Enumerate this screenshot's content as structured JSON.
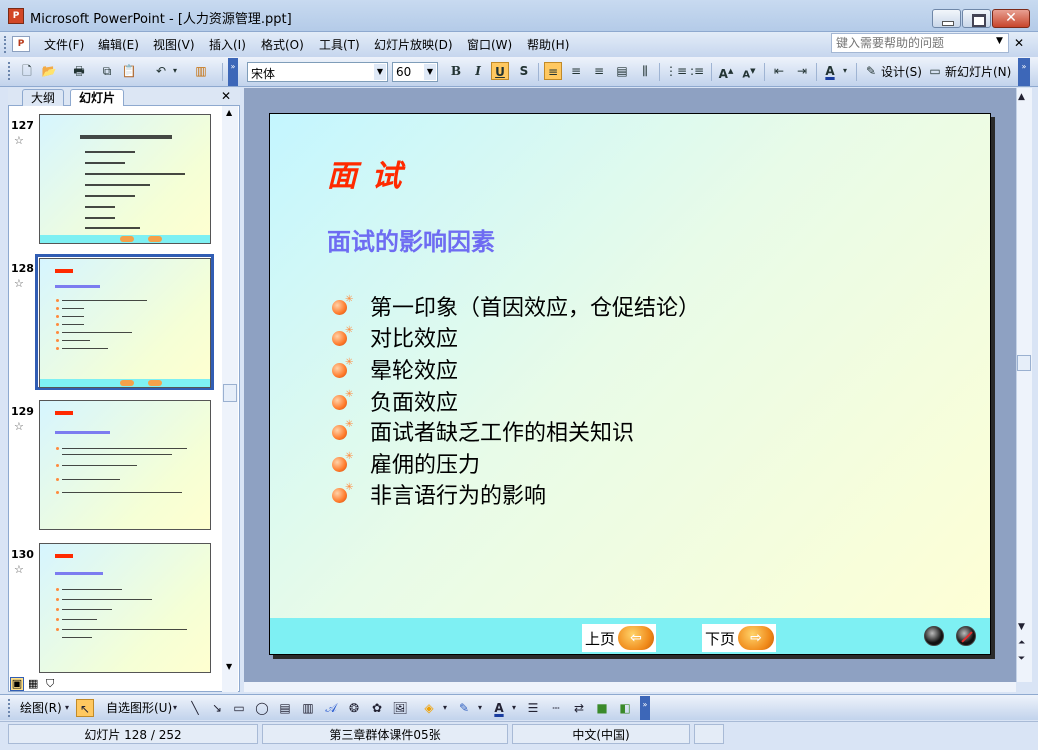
{
  "window": {
    "title": "Microsoft PowerPoint - [人力资源管理.ppt]",
    "app_icon": "P",
    "close_glyph": "✕"
  },
  "menu": {
    "items": [
      "文件(F)",
      "编辑(E)",
      "视图(V)",
      "插入(I)",
      "格式(O)",
      "工具(T)",
      "幻灯片放映(D)",
      "窗口(W)",
      "帮助(H)"
    ],
    "help_placeholder": "键入需要帮助的问题",
    "help_close": "✕"
  },
  "toolbar": {
    "font": "宋体",
    "size": "60",
    "bold": "B",
    "italic": "I",
    "underline": "U",
    "shadow": "S",
    "design_label": "设计(S)",
    "new_slide_label": "新幻灯片(N)"
  },
  "left_pane": {
    "tabs": [
      "大纲",
      "幻灯片"
    ],
    "close": "✕",
    "thumbnails": [
      {
        "number": "127",
        "star": "☆"
      },
      {
        "number": "128",
        "star": "☆"
      },
      {
        "number": "129",
        "star": "☆"
      },
      {
        "number": "130",
        "star": "☆"
      }
    ]
  },
  "slide": {
    "title": "面 试",
    "subtitle": "面试的影响因素",
    "bullets": [
      "第一印象（首因效应，仓促结论）",
      "对比效应",
      "晕轮效应",
      "负面效应",
      "面试者缺乏工作的相关知识",
      "雇佣的压力",
      "非言语行为的影响"
    ],
    "prev_label": "上页",
    "next_label": "下页"
  },
  "drawing_toolbar": {
    "draw_label": "绘图(R)",
    "autoshape_label": "自选图形(U)"
  },
  "status": {
    "slide_position": "幻灯片 128 / 252",
    "design": "第三章群体课件05张",
    "language": "中文(中国)"
  }
}
